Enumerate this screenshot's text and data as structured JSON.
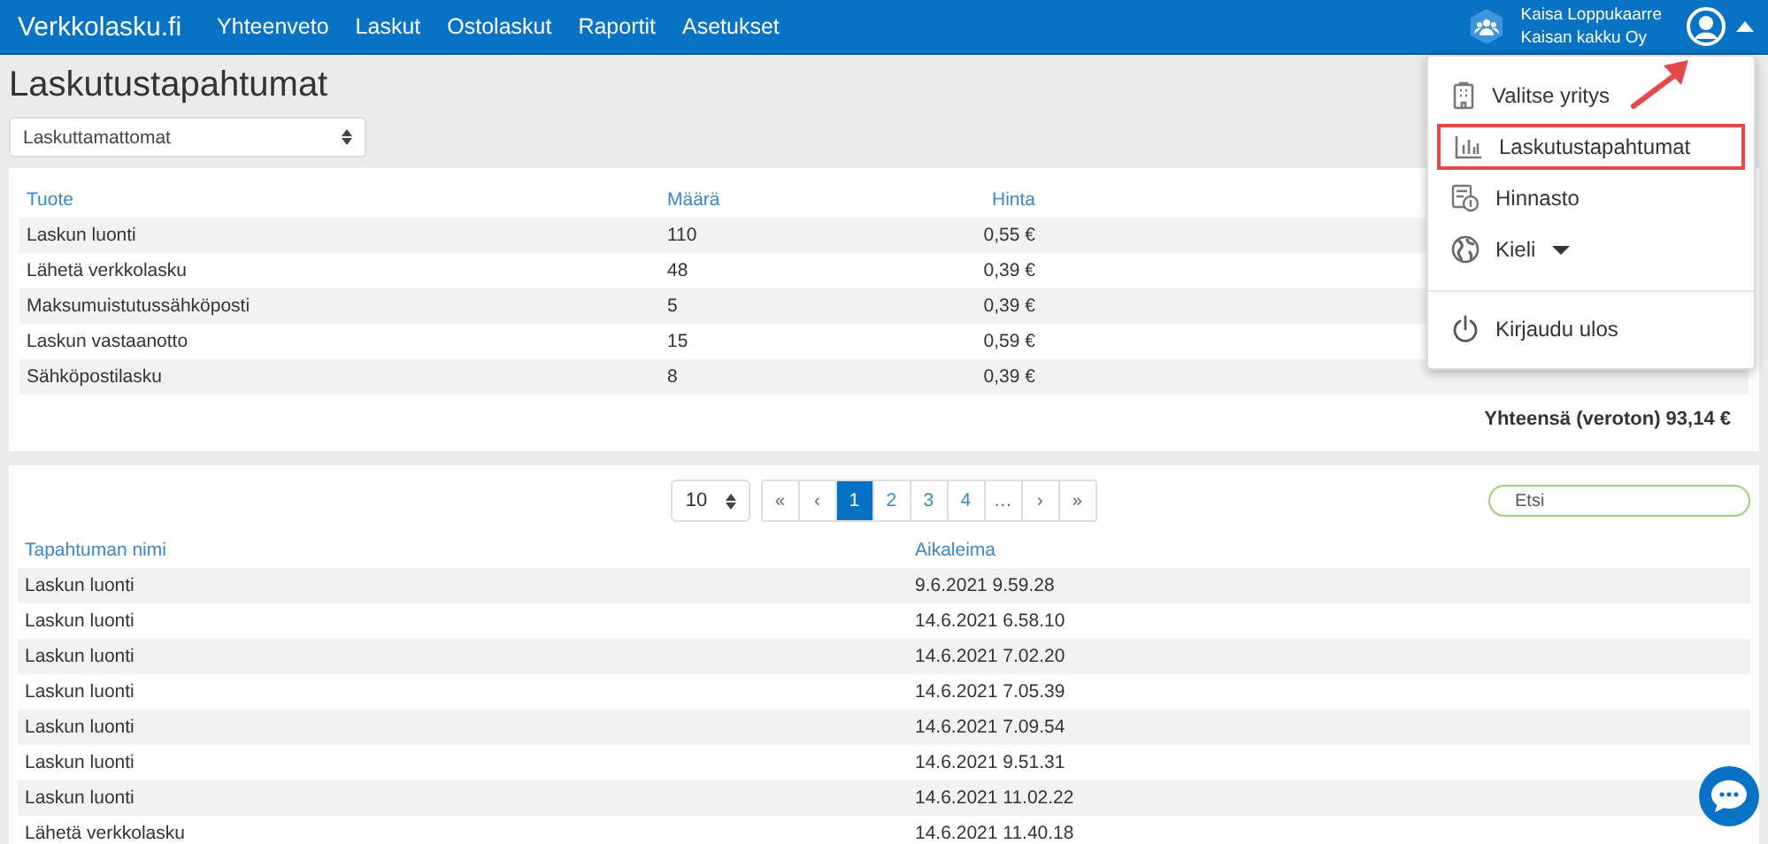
{
  "header": {
    "brand": "Verkkolasku.fi",
    "nav": [
      {
        "label": "Yhteenveto"
      },
      {
        "label": "Laskut"
      },
      {
        "label": "Ostolaskut"
      },
      {
        "label": "Raportit"
      },
      {
        "label": "Asetukset"
      }
    ],
    "user": {
      "name": "Kaisa Loppukaarre",
      "company": "Kaisan kakku Oy"
    },
    "menu_open": true
  },
  "page": {
    "title": "Laskutustapahtumat",
    "filter": {
      "value": "Laskuttamattomat"
    }
  },
  "summary_table": {
    "columns": [
      "Tuote",
      "Määrä",
      "Hinta"
    ],
    "rows": [
      [
        "Laskun luonti",
        "110",
        "0,55 €"
      ],
      [
        "Lähetä verkkolasku",
        "48",
        "0,39 €"
      ],
      [
        "Maksumuistutussähköposti",
        "5",
        "0,39 €"
      ],
      [
        "Laskun vastaanotto",
        "15",
        "0,59 €"
      ],
      [
        "Sähköpostilasku",
        "8",
        "0,39 €"
      ]
    ],
    "total": "Yhteensä (veroton) 93,14 €"
  },
  "events": {
    "page_size": "10",
    "pagination": [
      {
        "label": "«",
        "kind": "nav",
        "selected": false
      },
      {
        "label": "‹",
        "kind": "nav",
        "selected": false
      },
      {
        "label": "1",
        "kind": "page",
        "selected": true
      },
      {
        "label": "2",
        "kind": "page",
        "selected": false
      },
      {
        "label": "3",
        "kind": "page",
        "selected": false
      },
      {
        "label": "4",
        "kind": "page",
        "selected": false
      },
      {
        "label": "…",
        "kind": "gap",
        "selected": false
      },
      {
        "label": "›",
        "kind": "nav",
        "selected": false
      },
      {
        "label": "»",
        "kind": "nav",
        "selected": false
      }
    ],
    "search": {
      "placeholder": "Etsi"
    },
    "columns": [
      "Tapahtuman nimi",
      "Aikaleima"
    ],
    "rows": [
      [
        "Laskun luonti",
        "9.6.2021 9.59.28"
      ],
      [
        "Laskun luonti",
        "14.6.2021 6.58.10"
      ],
      [
        "Laskun luonti",
        "14.6.2021 7.02.20"
      ],
      [
        "Laskun luonti",
        "14.6.2021 7.05.39"
      ],
      [
        "Laskun luonti",
        "14.6.2021 7.09.54"
      ],
      [
        "Laskun luonti",
        "14.6.2021 9.51.31"
      ],
      [
        "Laskun luonti",
        "14.6.2021 11.02.22"
      ],
      [
        "Lähetä verkkolasku",
        "14.6.2021 11.40.18"
      ]
    ]
  },
  "user_menu": {
    "items": [
      {
        "label": "Valitse yritys",
        "highlighted": false
      },
      {
        "label": "Laskutustapahtumat",
        "highlighted": true
      },
      {
        "label": "Hinnasto",
        "highlighted": false
      },
      {
        "label": "Kieli",
        "highlighted": false,
        "submenu": true
      },
      {
        "label": "Kirjaudu ulos",
        "highlighted": false,
        "divider_before": true
      }
    ]
  }
}
